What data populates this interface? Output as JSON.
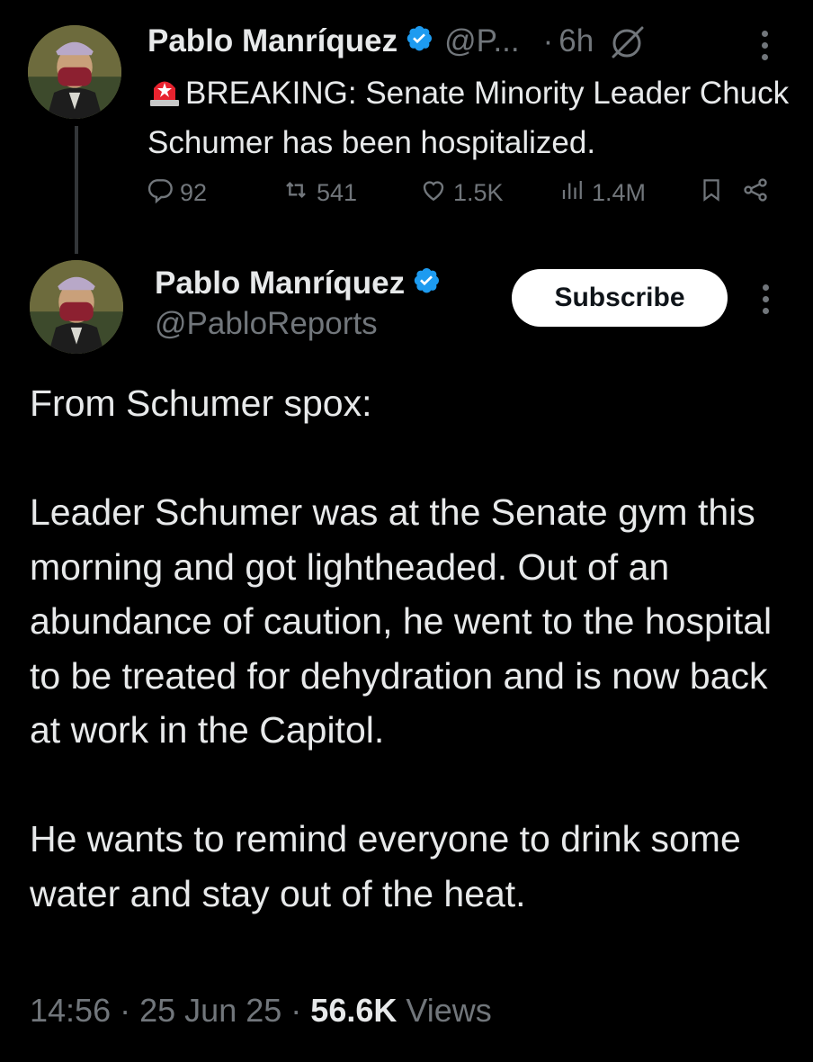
{
  "parent_tweet": {
    "author_name": "Pablo Manríquez",
    "handle": "@P...",
    "separator": "·",
    "time": "6h",
    "text": "BREAKING: Senate Minority Leader Chuck Schumer has been hospitalized.",
    "alarm_icon": "rotating-light-icon",
    "actions": {
      "replies": "92",
      "reposts": "541",
      "likes": "1.5K",
      "views": "1.4M"
    }
  },
  "main_tweet": {
    "author_name": "Pablo Manríquez",
    "handle": "@PabloReports",
    "subscribe_label": "Subscribe",
    "body": "From Schumer spox:\n\nLeader Schumer was at the Senate gym this morning and got lightheaded. Out of an abundance of caution, he went to the hospital to be treated for dehydration and is now back at work in the Capitol.\n\nHe wants to remind everyone to drink some water and stay out of the heat.",
    "time": "14:56",
    "date": "25 Jun 25",
    "views_count": "56.6K",
    "views_label": "Views",
    "separator": "·"
  },
  "colors": {
    "background": "#000000",
    "text": "#e7e9ea",
    "muted": "#71767b",
    "verified": "#1d9bf0",
    "thread_line": "#333639"
  }
}
